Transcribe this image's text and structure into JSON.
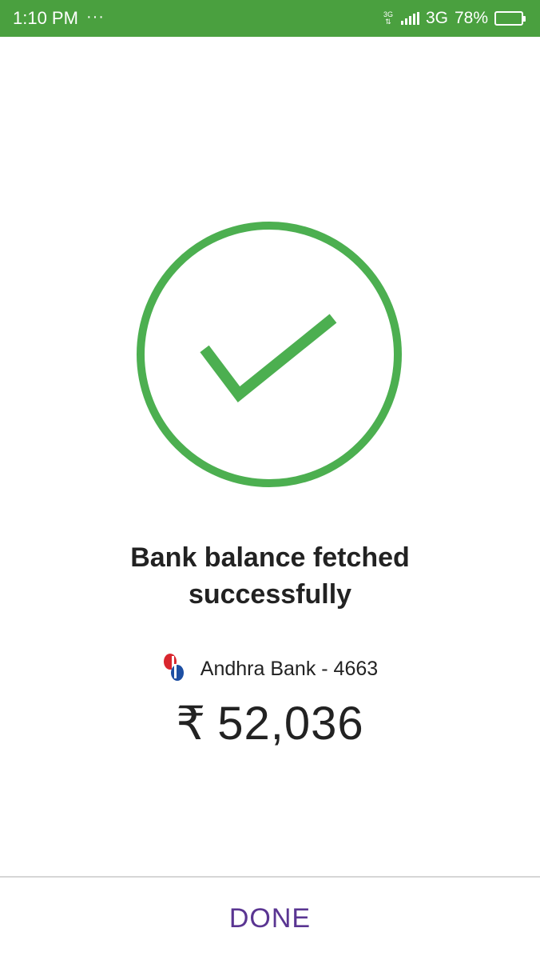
{
  "status_bar": {
    "time": "1:10 PM",
    "dots": "···",
    "network_small_top": "3G",
    "network_small_bottom": "⇅",
    "network_type": "3G",
    "battery_percent_text": "78%",
    "battery_level": 0.78,
    "background_color": "#4aa03f"
  },
  "success": {
    "icon": "check-circle-icon",
    "color": "#4caf50",
    "title_line1": "Bank balance fetched",
    "title_line2": "successfully"
  },
  "account": {
    "bank_logo_icon": "andhra-bank-logo",
    "bank_label": "Andhra Bank - 4663",
    "currency_symbol": "₹",
    "balance": "52,036"
  },
  "footer": {
    "done_label": "DONE",
    "done_color": "#5a3592"
  }
}
